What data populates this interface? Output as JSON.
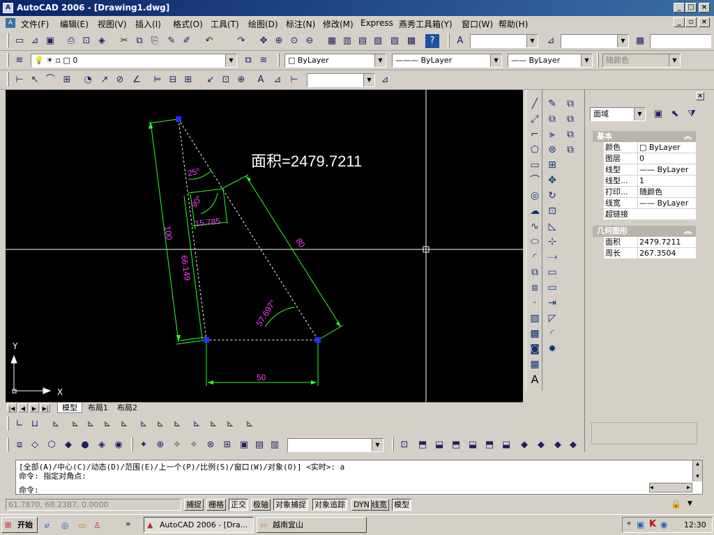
{
  "window": {
    "title": "AutoCAD 2006 - [Drawing1.dwg]",
    "app_icon": "A"
  },
  "menu": [
    "文件(F)",
    "编辑(E)",
    "视图(V)",
    "插入(I)",
    "格式(O)",
    "工具(T)",
    "绘图(D)",
    "标注(N)",
    "修改(M)",
    "Express",
    "燕秀工具箱(Y)",
    "窗口(W)",
    "帮助(H)"
  ],
  "layers": {
    "current_layer": "0",
    "color": "ByLayer",
    "linetype": "ByLayer",
    "lineweight": "ByLayer",
    "plotstyle": "随颜色"
  },
  "drawing": {
    "area_label": "面积=2479.7211",
    "dims": {
      "angle_25": "25°",
      "angle_90": "90°",
      "len_15": "15.785",
      "len_100": "100",
      "len_66": "66.149",
      "len_80": "80",
      "angle_57": "57.697°",
      "len_50": "50"
    },
    "ucs": {
      "x": "X",
      "y": "Y"
    }
  },
  "tabs": {
    "model": "模型",
    "layout1": "布局1",
    "layout2": "布局2"
  },
  "properties": {
    "selector": "面域",
    "sections": {
      "general": "基本",
      "geometry": "几何图形"
    },
    "general_rows": [
      {
        "label": "颜色",
        "value": "□ ByLayer"
      },
      {
        "label": "图层",
        "value": "0"
      },
      {
        "label": "线型",
        "value": "—— ByLayer"
      },
      {
        "label": "线型...",
        "value": "1"
      },
      {
        "label": "打印...",
        "value": "随颜色"
      },
      {
        "label": "线宽",
        "value": "—— ByLayer"
      },
      {
        "label": "超链接",
        "value": ""
      }
    ],
    "geometry_rows": [
      {
        "label": "面积",
        "value": "2479.7211"
      },
      {
        "label": "周长",
        "value": "267.3504"
      }
    ]
  },
  "command": {
    "line1": "[全部(A)/中心(C)/动态(D)/范围(E)/上一个(P)/比例(S)/窗口(W)/对象(O)] <实时>: a",
    "line2": "命令: 指定对角点:",
    "line3": "命令:"
  },
  "status": {
    "coords": "61.7870, 68.2387, 0.0000",
    "buttons": [
      "捕捉",
      "栅格",
      "正交",
      "极轴",
      "对象捕捉",
      "对象追踪",
      "DYN",
      "线宽",
      "模型"
    ]
  },
  "taskbar": {
    "start": "开始",
    "task1": "AutoCAD 2006 - [Dra...",
    "task2": "越南宜山",
    "clock": "12:30"
  }
}
